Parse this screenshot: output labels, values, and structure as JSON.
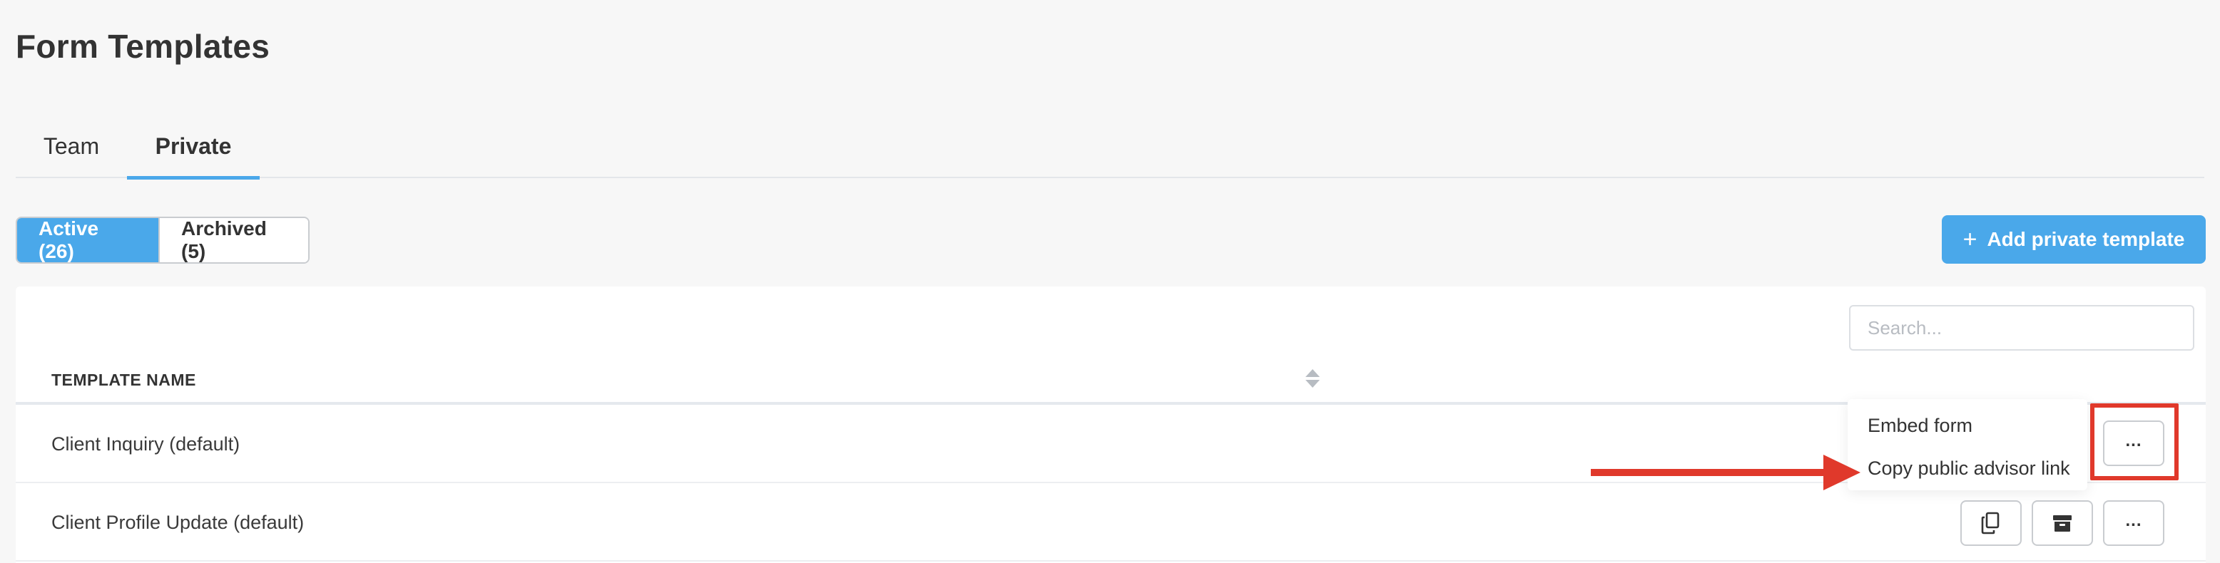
{
  "page": {
    "title": "Form Templates"
  },
  "tabs": [
    {
      "label": "Team"
    },
    {
      "label": "Private"
    }
  ],
  "toggle": {
    "active_label": "Active (26)",
    "archived_label": "Archived (5)"
  },
  "add_button": {
    "icon": "plus-icon",
    "label": "Add private template"
  },
  "search": {
    "placeholder": "Search...",
    "value": ""
  },
  "table": {
    "columns": [
      {
        "label": "TEMPLATE NAME",
        "sort_icon": "sort-icon"
      }
    ],
    "rows": [
      {
        "name": "Client Inquiry (default)",
        "more_label": "..."
      },
      {
        "name": "Client Profile Update (default)",
        "copy_icon": "copy-icon",
        "archive_icon": "archive-icon",
        "more_label": "..."
      }
    ]
  },
  "menu": {
    "items": [
      {
        "label": "Embed form"
      },
      {
        "label": "Copy public advisor link"
      }
    ]
  },
  "colors": {
    "accent": "#4aa8ea",
    "annotation": "#e0392b"
  }
}
